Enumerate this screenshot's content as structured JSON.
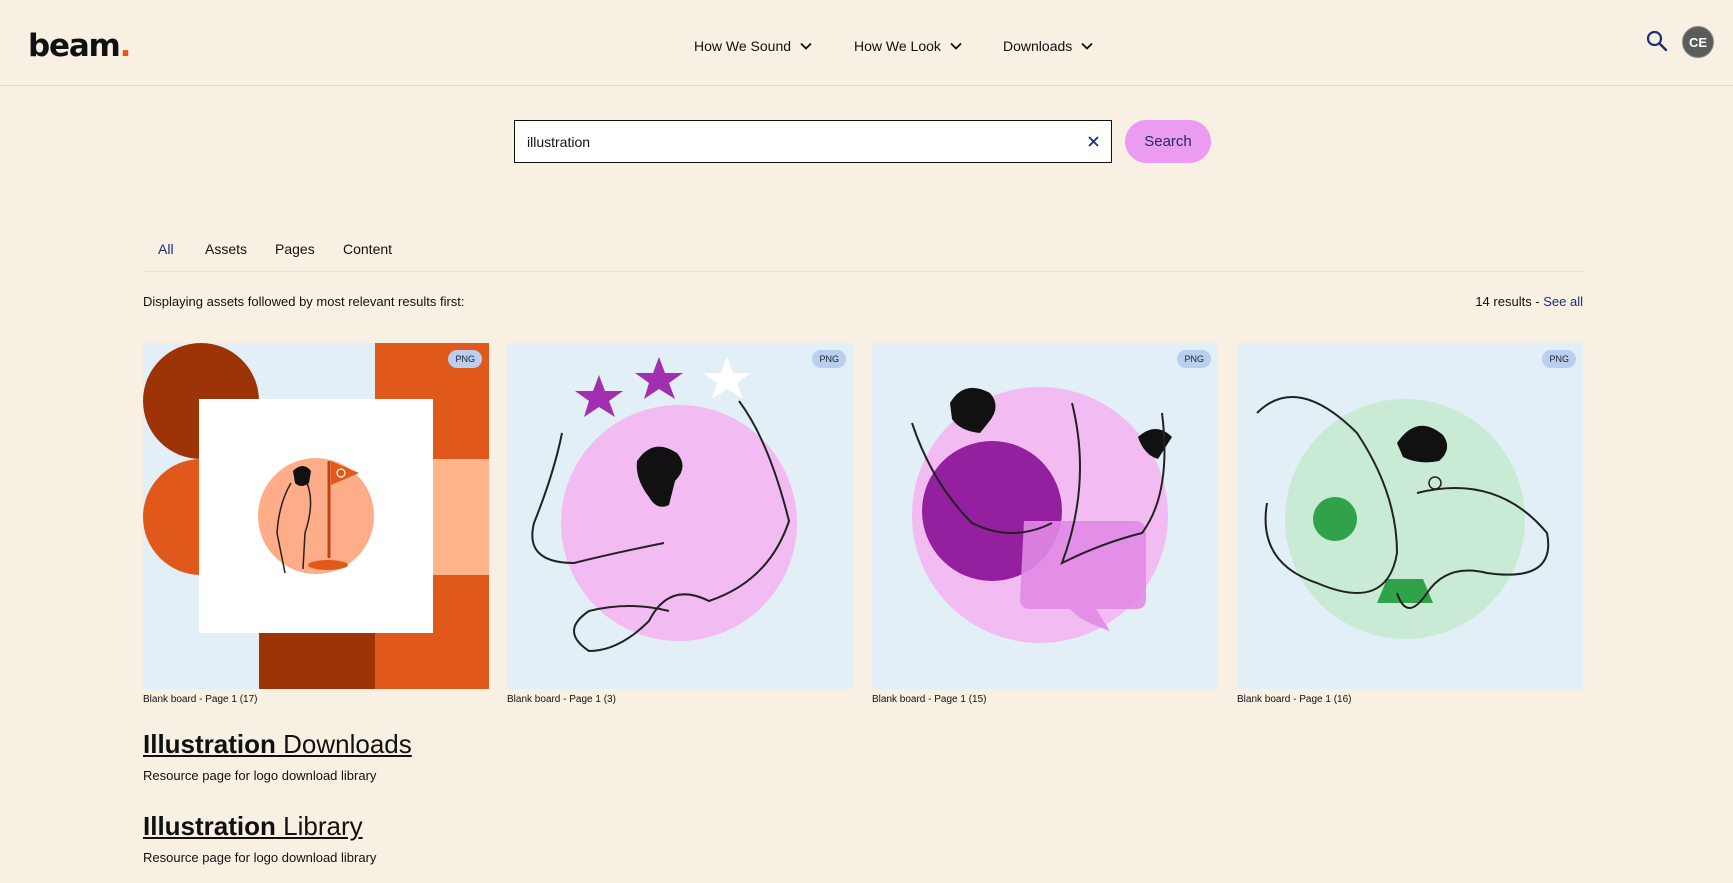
{
  "header": {
    "logo_text": "beam",
    "logo_dot": ".",
    "nav": [
      "How We Sound",
      "How We Look",
      "Downloads"
    ],
    "avatar_initials": "CE"
  },
  "search": {
    "value": "illustration",
    "placeholder": "",
    "button_label": "Search"
  },
  "tabs": [
    "All",
    "Assets",
    "Pages",
    "Content"
  ],
  "active_tab": "All",
  "info_text": "Displaying assets followed by most relevant results first:",
  "results_count": "14 results - ",
  "see_all": "See all",
  "assets": [
    {
      "badge": "PNG",
      "caption": "Blank board - Page 1 (17)"
    },
    {
      "badge": "PNG",
      "caption": "Blank board - Page 1 (3)"
    },
    {
      "badge": "PNG",
      "caption": "Blank board - Page 1 (15)"
    },
    {
      "badge": "PNG",
      "caption": "Blank board - Page 1 (16)"
    }
  ],
  "pages": [
    {
      "title_bold": "Illustration",
      "title_rest": " Downloads",
      "description": "Resource page for logo download library"
    },
    {
      "title_bold": "Illustration",
      "title_rest": " Library",
      "description": "Resource page for logo download library"
    }
  ],
  "colors": {
    "background": "#f8f0e2",
    "accent_link": "#1a2f7a",
    "search_button": "#eb9cf0",
    "logo_dot": "#e4571a"
  }
}
